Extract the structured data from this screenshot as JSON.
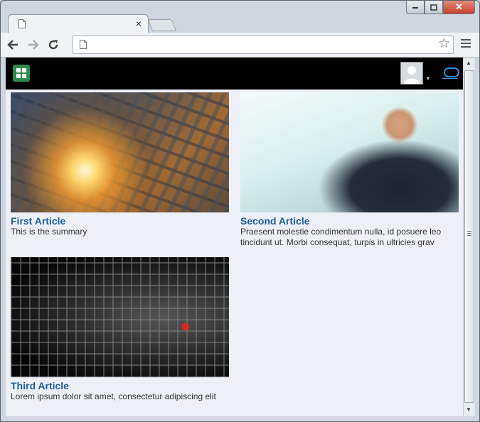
{
  "browser": {
    "tab": {
      "title": "",
      "close_label": "×"
    },
    "address": {
      "value": "",
      "placeholder": ""
    },
    "window_controls": {
      "close_label": "✕"
    }
  },
  "app": {
    "logo_icon": "grid-app-icon",
    "avatar_icon": "user-avatar",
    "brand_icon": "o-brand-icon"
  },
  "articles": [
    {
      "title": "First Article",
      "summary": "This is the summary"
    },
    {
      "title": "Second Article",
      "summary": "Praesent molestie condimentum nulla, id posuere leo tincidunt ut. Morbi consequat, turpis in ultricies grav"
    },
    {
      "title": "Third Article",
      "summary": "Lorem ipsum dolor sit amet, consectetur adipiscing elit"
    }
  ]
}
